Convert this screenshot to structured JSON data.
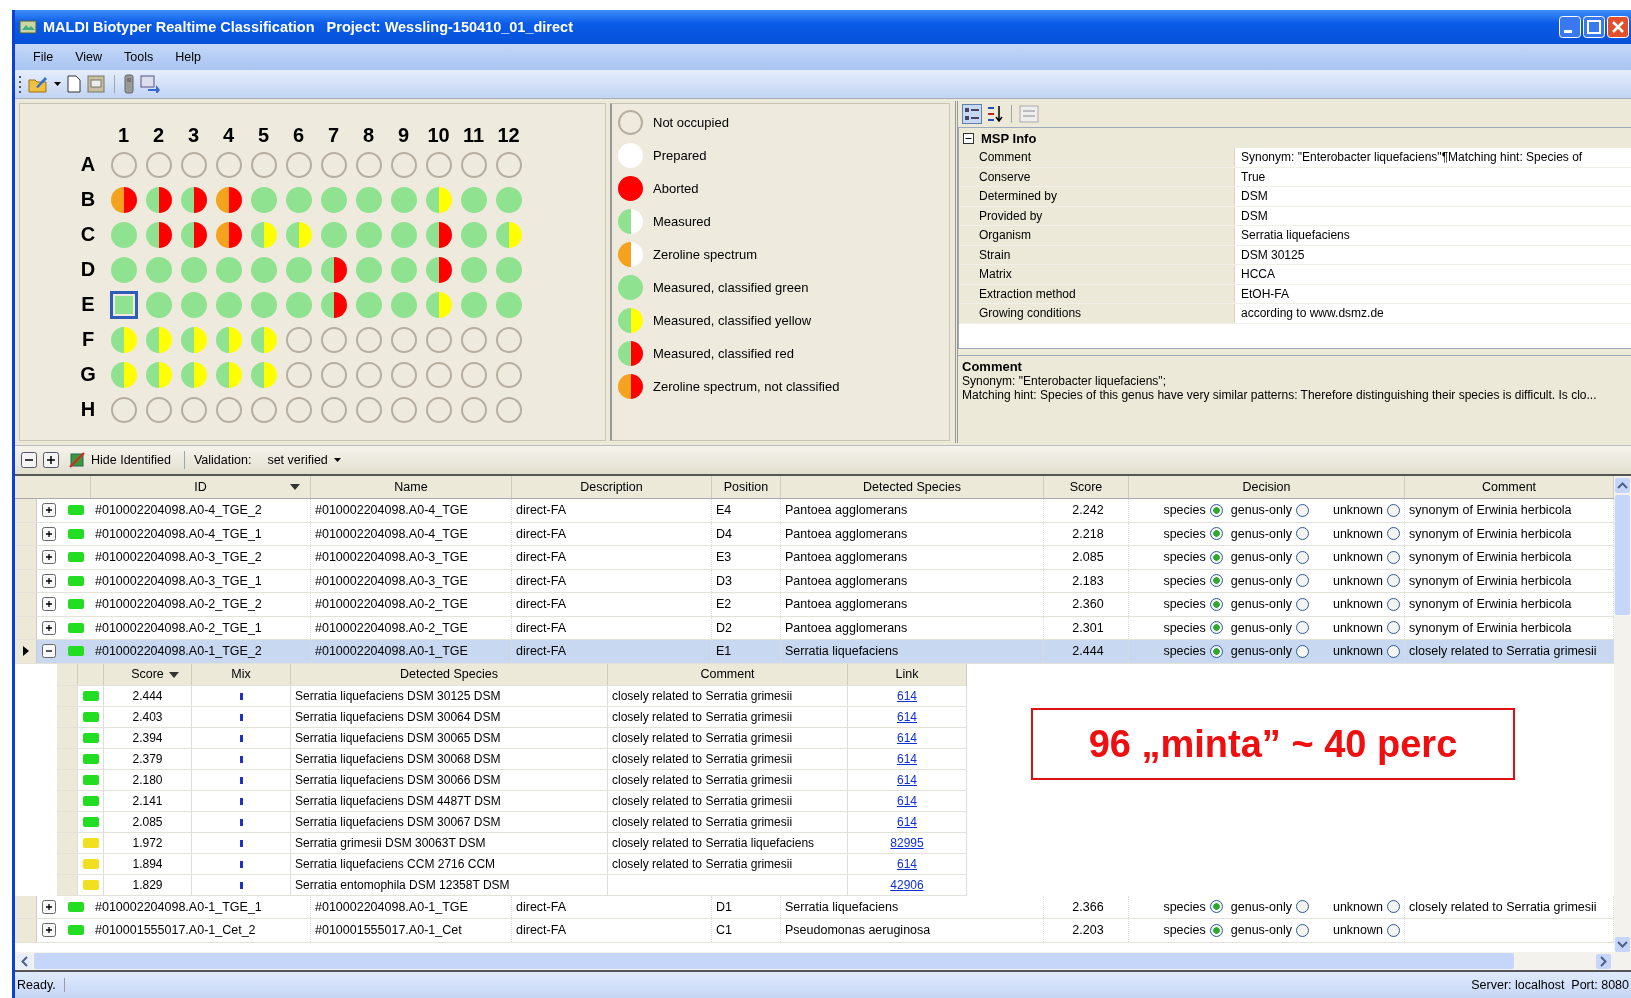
{
  "window": {
    "title": "MALDI Biotyper Realtime Classification   Project: Wessling-150410_01_direct"
  },
  "menu": [
    "File",
    "View",
    "Tools",
    "Help"
  ],
  "plate": {
    "columns": [
      "1",
      "2",
      "3",
      "4",
      "5",
      "6",
      "7",
      "8",
      "9",
      "10",
      "11",
      "12"
    ],
    "rows": [
      {
        "label": "A",
        "wells": [
          {
            "kind": "empty",
            "selected": false
          },
          {
            "kind": "empty",
            "selected": false
          },
          {
            "kind": "empty",
            "selected": false
          },
          {
            "kind": "empty",
            "selected": false
          },
          {
            "kind": "empty",
            "selected": false
          },
          {
            "kind": "empty",
            "selected": false
          },
          {
            "kind": "empty",
            "selected": false
          },
          {
            "kind": "empty",
            "selected": false
          },
          {
            "kind": "empty",
            "selected": false
          },
          {
            "kind": "empty",
            "selected": false
          },
          {
            "kind": "empty",
            "selected": false
          },
          {
            "kind": "empty",
            "selected": false
          }
        ]
      },
      {
        "label": "B",
        "wells": [
          {
            "kind": "zeroline_red",
            "selected": false
          },
          {
            "kind": "red",
            "selected": false
          },
          {
            "kind": "red",
            "selected": false
          },
          {
            "kind": "zeroline_red",
            "selected": false
          },
          {
            "kind": "green",
            "selected": false
          },
          {
            "kind": "green",
            "selected": false
          },
          {
            "kind": "green",
            "selected": false
          },
          {
            "kind": "green",
            "selected": false
          },
          {
            "kind": "green",
            "selected": false
          },
          {
            "kind": "yellow",
            "selected": false
          },
          {
            "kind": "green",
            "selected": false
          },
          {
            "kind": "green",
            "selected": false
          }
        ]
      },
      {
        "label": "C",
        "wells": [
          {
            "kind": "green",
            "selected": false
          },
          {
            "kind": "red",
            "selected": false
          },
          {
            "kind": "red",
            "selected": false
          },
          {
            "kind": "zeroline_red",
            "selected": false
          },
          {
            "kind": "yellow",
            "selected": false
          },
          {
            "kind": "yellow",
            "selected": false
          },
          {
            "kind": "green",
            "selected": false
          },
          {
            "kind": "green",
            "selected": false
          },
          {
            "kind": "green",
            "selected": false
          },
          {
            "kind": "red",
            "selected": false
          },
          {
            "kind": "green",
            "selected": false
          },
          {
            "kind": "yellow",
            "selected": false
          }
        ]
      },
      {
        "label": "D",
        "wells": [
          {
            "kind": "green",
            "selected": false
          },
          {
            "kind": "green",
            "selected": false
          },
          {
            "kind": "green",
            "selected": false
          },
          {
            "kind": "green",
            "selected": false
          },
          {
            "kind": "green",
            "selected": false
          },
          {
            "kind": "green",
            "selected": false
          },
          {
            "kind": "red",
            "selected": false
          },
          {
            "kind": "green",
            "selected": false
          },
          {
            "kind": "green",
            "selected": false
          },
          {
            "kind": "red",
            "selected": false
          },
          {
            "kind": "green",
            "selected": false
          },
          {
            "kind": "green",
            "selected": false
          }
        ]
      },
      {
        "label": "E",
        "wells": [
          {
            "kind": "green",
            "selected": true
          },
          {
            "kind": "green",
            "selected": false
          },
          {
            "kind": "green",
            "selected": false
          },
          {
            "kind": "green",
            "selected": false
          },
          {
            "kind": "green",
            "selected": false
          },
          {
            "kind": "green",
            "selected": false
          },
          {
            "kind": "red",
            "selected": false
          },
          {
            "kind": "green",
            "selected": false
          },
          {
            "kind": "green",
            "selected": false
          },
          {
            "kind": "yellow",
            "selected": false
          },
          {
            "kind": "green",
            "selected": false
          },
          {
            "kind": "green",
            "selected": false
          }
        ]
      },
      {
        "label": "F",
        "wells": [
          {
            "kind": "yellow",
            "selected": false
          },
          {
            "kind": "yellow",
            "selected": false
          },
          {
            "kind": "yellow",
            "selected": false
          },
          {
            "kind": "yellow",
            "selected": false
          },
          {
            "kind": "yellow",
            "selected": false
          },
          {
            "kind": "empty",
            "selected": false
          },
          {
            "kind": "empty",
            "selected": false
          },
          {
            "kind": "empty",
            "selected": false
          },
          {
            "kind": "empty",
            "selected": false
          },
          {
            "kind": "empty",
            "selected": false
          },
          {
            "kind": "empty",
            "selected": false
          },
          {
            "kind": "empty",
            "selected": false
          }
        ]
      },
      {
        "label": "G",
        "wells": [
          {
            "kind": "yellow",
            "selected": false
          },
          {
            "kind": "yellow",
            "selected": false
          },
          {
            "kind": "yellow",
            "selected": false
          },
          {
            "kind": "yellow",
            "selected": false
          },
          {
            "kind": "yellow",
            "selected": false
          },
          {
            "kind": "empty",
            "selected": false
          },
          {
            "kind": "empty",
            "selected": false
          },
          {
            "kind": "empty",
            "selected": false
          },
          {
            "kind": "empty",
            "selected": false
          },
          {
            "kind": "empty",
            "selected": false
          },
          {
            "kind": "empty",
            "selected": false
          },
          {
            "kind": "empty",
            "selected": false
          }
        ]
      },
      {
        "label": "H",
        "wells": [
          {
            "kind": "empty",
            "selected": false
          },
          {
            "kind": "empty",
            "selected": false
          },
          {
            "kind": "empty",
            "selected": false
          },
          {
            "kind": "empty",
            "selected": false
          },
          {
            "kind": "empty",
            "selected": false
          },
          {
            "kind": "empty",
            "selected": false
          },
          {
            "kind": "empty",
            "selected": false
          },
          {
            "kind": "empty",
            "selected": false
          },
          {
            "kind": "empty",
            "selected": false
          },
          {
            "kind": "empty",
            "selected": false
          },
          {
            "kind": "empty",
            "selected": false
          },
          {
            "kind": "empty",
            "selected": false
          }
        ]
      }
    ]
  },
  "legend": [
    {
      "kind": "empty",
      "label": "Not occupied"
    },
    {
      "kind": "prepared",
      "label": "Prepared"
    },
    {
      "kind": "aborted",
      "label": "Aborted"
    },
    {
      "kind": "measured",
      "label": "Measured"
    },
    {
      "kind": "zeroline",
      "label": "Zeroline spectrum"
    },
    {
      "kind": "green",
      "label": "Measured, classified green"
    },
    {
      "kind": "yellow",
      "label": "Measured, classified yellow"
    },
    {
      "kind": "red",
      "label": "Measured, classified red"
    },
    {
      "kind": "zeroline_red",
      "label": "Zeroline spectrum, not classified"
    }
  ],
  "properties": {
    "category": {
      "label": "MSP Info",
      "expanded": true
    },
    "items": [
      {
        "name": "Comment",
        "value": "Synonym: \"Enterobacter liquefaciens\"¶Matching hint: Species of"
      },
      {
        "name": "Conserve",
        "value": "True"
      },
      {
        "name": "Determined by",
        "value": "DSM"
      },
      {
        "name": "Provided by",
        "value": "DSM"
      },
      {
        "name": "Organism",
        "value": "Serratia liquefaciens"
      },
      {
        "name": "Strain",
        "value": "DSM 30125"
      },
      {
        "name": "Matrix",
        "value": "HCCA"
      },
      {
        "name": "Extraction method",
        "value": "EtOH-FA"
      },
      {
        "name": "Growing conditions",
        "value": "according to www.dsmz.de"
      }
    ],
    "description": {
      "title": "Comment",
      "lines": [
        "Synonym: \"Enterobacter liquefaciens\";",
        "Matching hint: Species of this genus have very similar patterns: Therefore distinguishing their species is difficult. Is clo..."
      ]
    }
  },
  "grid_toolbar": {
    "hide_identified": "Hide Identified",
    "validation_label": "Validation:",
    "validation_value": "set verified"
  },
  "table": {
    "columns": [
      "ID",
      "Name",
      "Description",
      "Position",
      "Detected Species",
      "Score",
      "Decision",
      "Comment"
    ],
    "rows": [
      {
        "selected": false,
        "expanded": false,
        "color": "#22dd22",
        "id": "#010002204098.A0-4_TGE_2",
        "name": "#010002204098.A0-4_TGE",
        "description": "direct-FA",
        "position": "E4",
        "species": "Pantoea agglomerans",
        "score": "2.242",
        "decision": [
          {
            "label": "species",
            "selected": true
          },
          {
            "label": "genus-only",
            "selected": false
          },
          {
            "label": "unknown",
            "selected": false
          }
        ],
        "comment": "synonym of Erwinia herbicola"
      },
      {
        "selected": false,
        "expanded": false,
        "color": "#22dd22",
        "id": "#010002204098.A0-4_TGE_1",
        "name": "#010002204098.A0-4_TGE",
        "description": "direct-FA",
        "position": "D4",
        "species": "Pantoea agglomerans",
        "score": "2.218",
        "decision": [
          {
            "label": "species",
            "selected": true
          },
          {
            "label": "genus-only",
            "selected": false
          },
          {
            "label": "unknown",
            "selected": false
          }
        ],
        "comment": "synonym of Erwinia herbicola"
      },
      {
        "selected": false,
        "expanded": false,
        "color": "#22dd22",
        "id": "#010002204098.A0-3_TGE_2",
        "name": "#010002204098.A0-3_TGE",
        "description": "direct-FA",
        "position": "E3",
        "species": "Pantoea agglomerans",
        "score": "2.085",
        "decision": [
          {
            "label": "species",
            "selected": true
          },
          {
            "label": "genus-only",
            "selected": false
          },
          {
            "label": "unknown",
            "selected": false
          }
        ],
        "comment": "synonym of Erwinia herbicola"
      },
      {
        "selected": false,
        "expanded": false,
        "color": "#22dd22",
        "id": "#010002204098.A0-3_TGE_1",
        "name": "#010002204098.A0-3_TGE",
        "description": "direct-FA",
        "position": "D3",
        "species": "Pantoea agglomerans",
        "score": "2.183",
        "decision": [
          {
            "label": "species",
            "selected": true
          },
          {
            "label": "genus-only",
            "selected": false
          },
          {
            "label": "unknown",
            "selected": false
          }
        ],
        "comment": "synonym of Erwinia herbicola"
      },
      {
        "selected": false,
        "expanded": false,
        "color": "#22dd22",
        "id": "#010002204098.A0-2_TGE_2",
        "name": "#010002204098.A0-2_TGE",
        "description": "direct-FA",
        "position": "E2",
        "species": "Pantoea agglomerans",
        "score": "2.360",
        "decision": [
          {
            "label": "species",
            "selected": true
          },
          {
            "label": "genus-only",
            "selected": false
          },
          {
            "label": "unknown",
            "selected": false
          }
        ],
        "comment": "synonym of Erwinia herbicola"
      },
      {
        "selected": false,
        "expanded": false,
        "color": "#22dd22",
        "id": "#010002204098.A0-2_TGE_1",
        "name": "#010002204098.A0-2_TGE",
        "description": "direct-FA",
        "position": "D2",
        "species": "Pantoea agglomerans",
        "score": "2.301",
        "decision": [
          {
            "label": "species",
            "selected": true
          },
          {
            "label": "genus-only",
            "selected": false
          },
          {
            "label": "unknown",
            "selected": false
          }
        ],
        "comment": "synonym of Erwinia herbicola"
      },
      {
        "selected": true,
        "expanded": true,
        "color": "#22dd22",
        "id": "#010002204098.A0-1_TGE_2",
        "name": "#010002204098.A0-1_TGE",
        "description": "direct-FA",
        "position": "E1",
        "species": "Serratia liquefaciens",
        "score": "2.444",
        "decision": [
          {
            "label": "species",
            "selected": true
          },
          {
            "label": "genus-only",
            "selected": false
          },
          {
            "label": "unknown",
            "selected": false
          }
        ],
        "comment": "closely related to Serratia grimesii",
        "matches": {
          "columns": [
            "Score",
            "Mix",
            "Detected Species",
            "Comment",
            "Link"
          ],
          "rows": [
            {
              "color": "#22dd22",
              "score": "2.444",
              "species": "Serratia liquefaciens DSM 30125 DSM",
              "comment": "closely related to Serratia grimesii",
              "link": "614"
            },
            {
              "color": "#22dd22",
              "score": "2.403",
              "species": "Serratia liquefaciens DSM 30064 DSM",
              "comment": "closely related to Serratia grimesii",
              "link": "614"
            },
            {
              "color": "#22dd22",
              "score": "2.394",
              "species": "Serratia liquefaciens DSM 30065 DSM",
              "comment": "closely related to Serratia grimesii",
              "link": "614"
            },
            {
              "color": "#22dd22",
              "score": "2.379",
              "species": "Serratia liquefaciens DSM 30068 DSM",
              "comment": "closely related to Serratia grimesii",
              "link": "614"
            },
            {
              "color": "#22dd22",
              "score": "2.180",
              "species": "Serratia liquefaciens DSM 30066 DSM",
              "comment": "closely related to Serratia grimesii",
              "link": "614"
            },
            {
              "color": "#22dd22",
              "score": "2.141",
              "species": "Serratia liquefaciens DSM 4487T DSM",
              "comment": "closely related to Serratia grimesii",
              "link": "614"
            },
            {
              "color": "#22dd22",
              "score": "2.085",
              "species": "Serratia liquefaciens DSM 30067 DSM",
              "comment": "closely related to Serratia grimesii",
              "link": "614"
            },
            {
              "color": "#f0e020",
              "score": "1.972",
              "species": "Serratia grimesii DSM 30063T DSM",
              "comment": "closely related to Serratia liquefaciens",
              "link": "82995"
            },
            {
              "color": "#f0e020",
              "score": "1.894",
              "species": "Serratia liquefaciens CCM 2716 CCM",
              "comment": "closely related to Serratia grimesii",
              "link": "614"
            },
            {
              "color": "#f0e020",
              "score": "1.829",
              "species": "Serratia entomophila DSM 12358T DSM",
              "link": "42906"
            }
          ]
        }
      },
      {
        "selected": false,
        "expanded": false,
        "color": "#22dd22",
        "id": "#010002204098.A0-1_TGE_1",
        "name": "#010002204098.A0-1_TGE",
        "description": "direct-FA",
        "position": "D1",
        "species": "Serratia liquefaciens",
        "score": "2.366",
        "decision": [
          {
            "label": "species",
            "selected": true
          },
          {
            "label": "genus-only",
            "selected": false
          },
          {
            "label": "unknown",
            "selected": false
          }
        ],
        "comment": "closely related to Serratia grimesii"
      },
      {
        "selected": false,
        "expanded": false,
        "color": "#22dd22",
        "id": "#010001555017.A0-1_Cet_2",
        "name": "#010001555017.A0-1_Cet",
        "description": "direct-FA",
        "position": "C1",
        "species": "Pseudomonas aeruginosa",
        "score": "2.203",
        "decision": [
          {
            "label": "species",
            "selected": true
          },
          {
            "label": "genus-only",
            "selected": false
          },
          {
            "label": "unknown",
            "selected": false
          }
        ]
      }
    ]
  },
  "annotation": "96 „minta” ~ 40 perc",
  "status_bar": {
    "message": "Ready.",
    "server": "Server: localhost  Port: 8080"
  }
}
